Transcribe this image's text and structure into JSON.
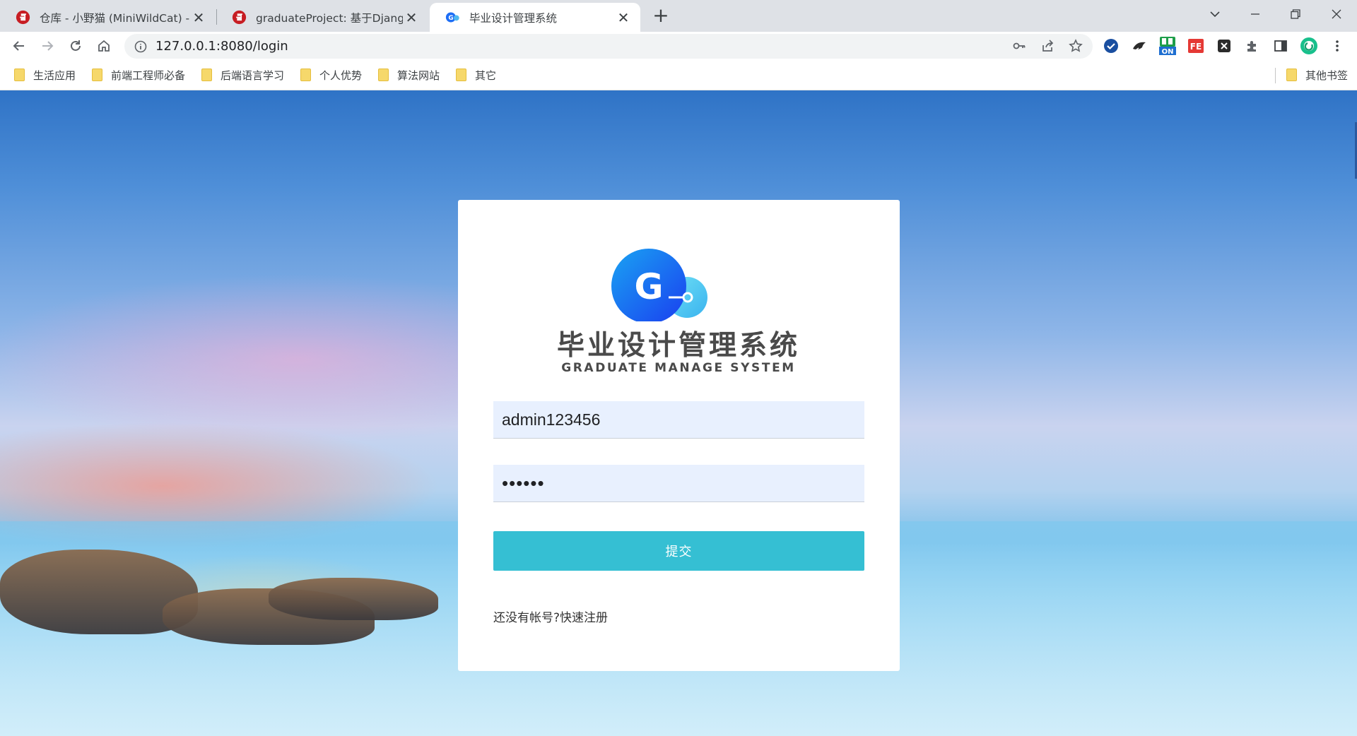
{
  "browser": {
    "tabs": [
      {
        "title": "仓库 - 小野猫 (MiniWildCat) - G",
        "active": false
      },
      {
        "title": "graduateProject: 基于Django打",
        "active": false
      },
      {
        "title": "毕业设计管理系统",
        "active": true
      }
    ],
    "url": "127.0.0.1:8080/login",
    "bookmarks": [
      "生活应用",
      "前端工程师必备",
      "后端语言学习",
      "个人优势",
      "算法网站",
      "其它"
    ],
    "other_bookmarks": "其他书签",
    "extension_badge": "ON",
    "extension_fe": "FE"
  },
  "login": {
    "logo_letter": "G",
    "title_cn": "毕业设计管理系统",
    "title_en": "GRADUATE MANAGE SYSTEM",
    "username_value": "admin123456",
    "password_value": "••••••",
    "submit_label": "提交",
    "register_prompt": "还没有帐号?",
    "register_link": "快速注册"
  },
  "colors": {
    "brand_blue": "#1e5ef5",
    "brand_cyan": "#35bfd3",
    "input_bg": "#e8f0fe"
  }
}
